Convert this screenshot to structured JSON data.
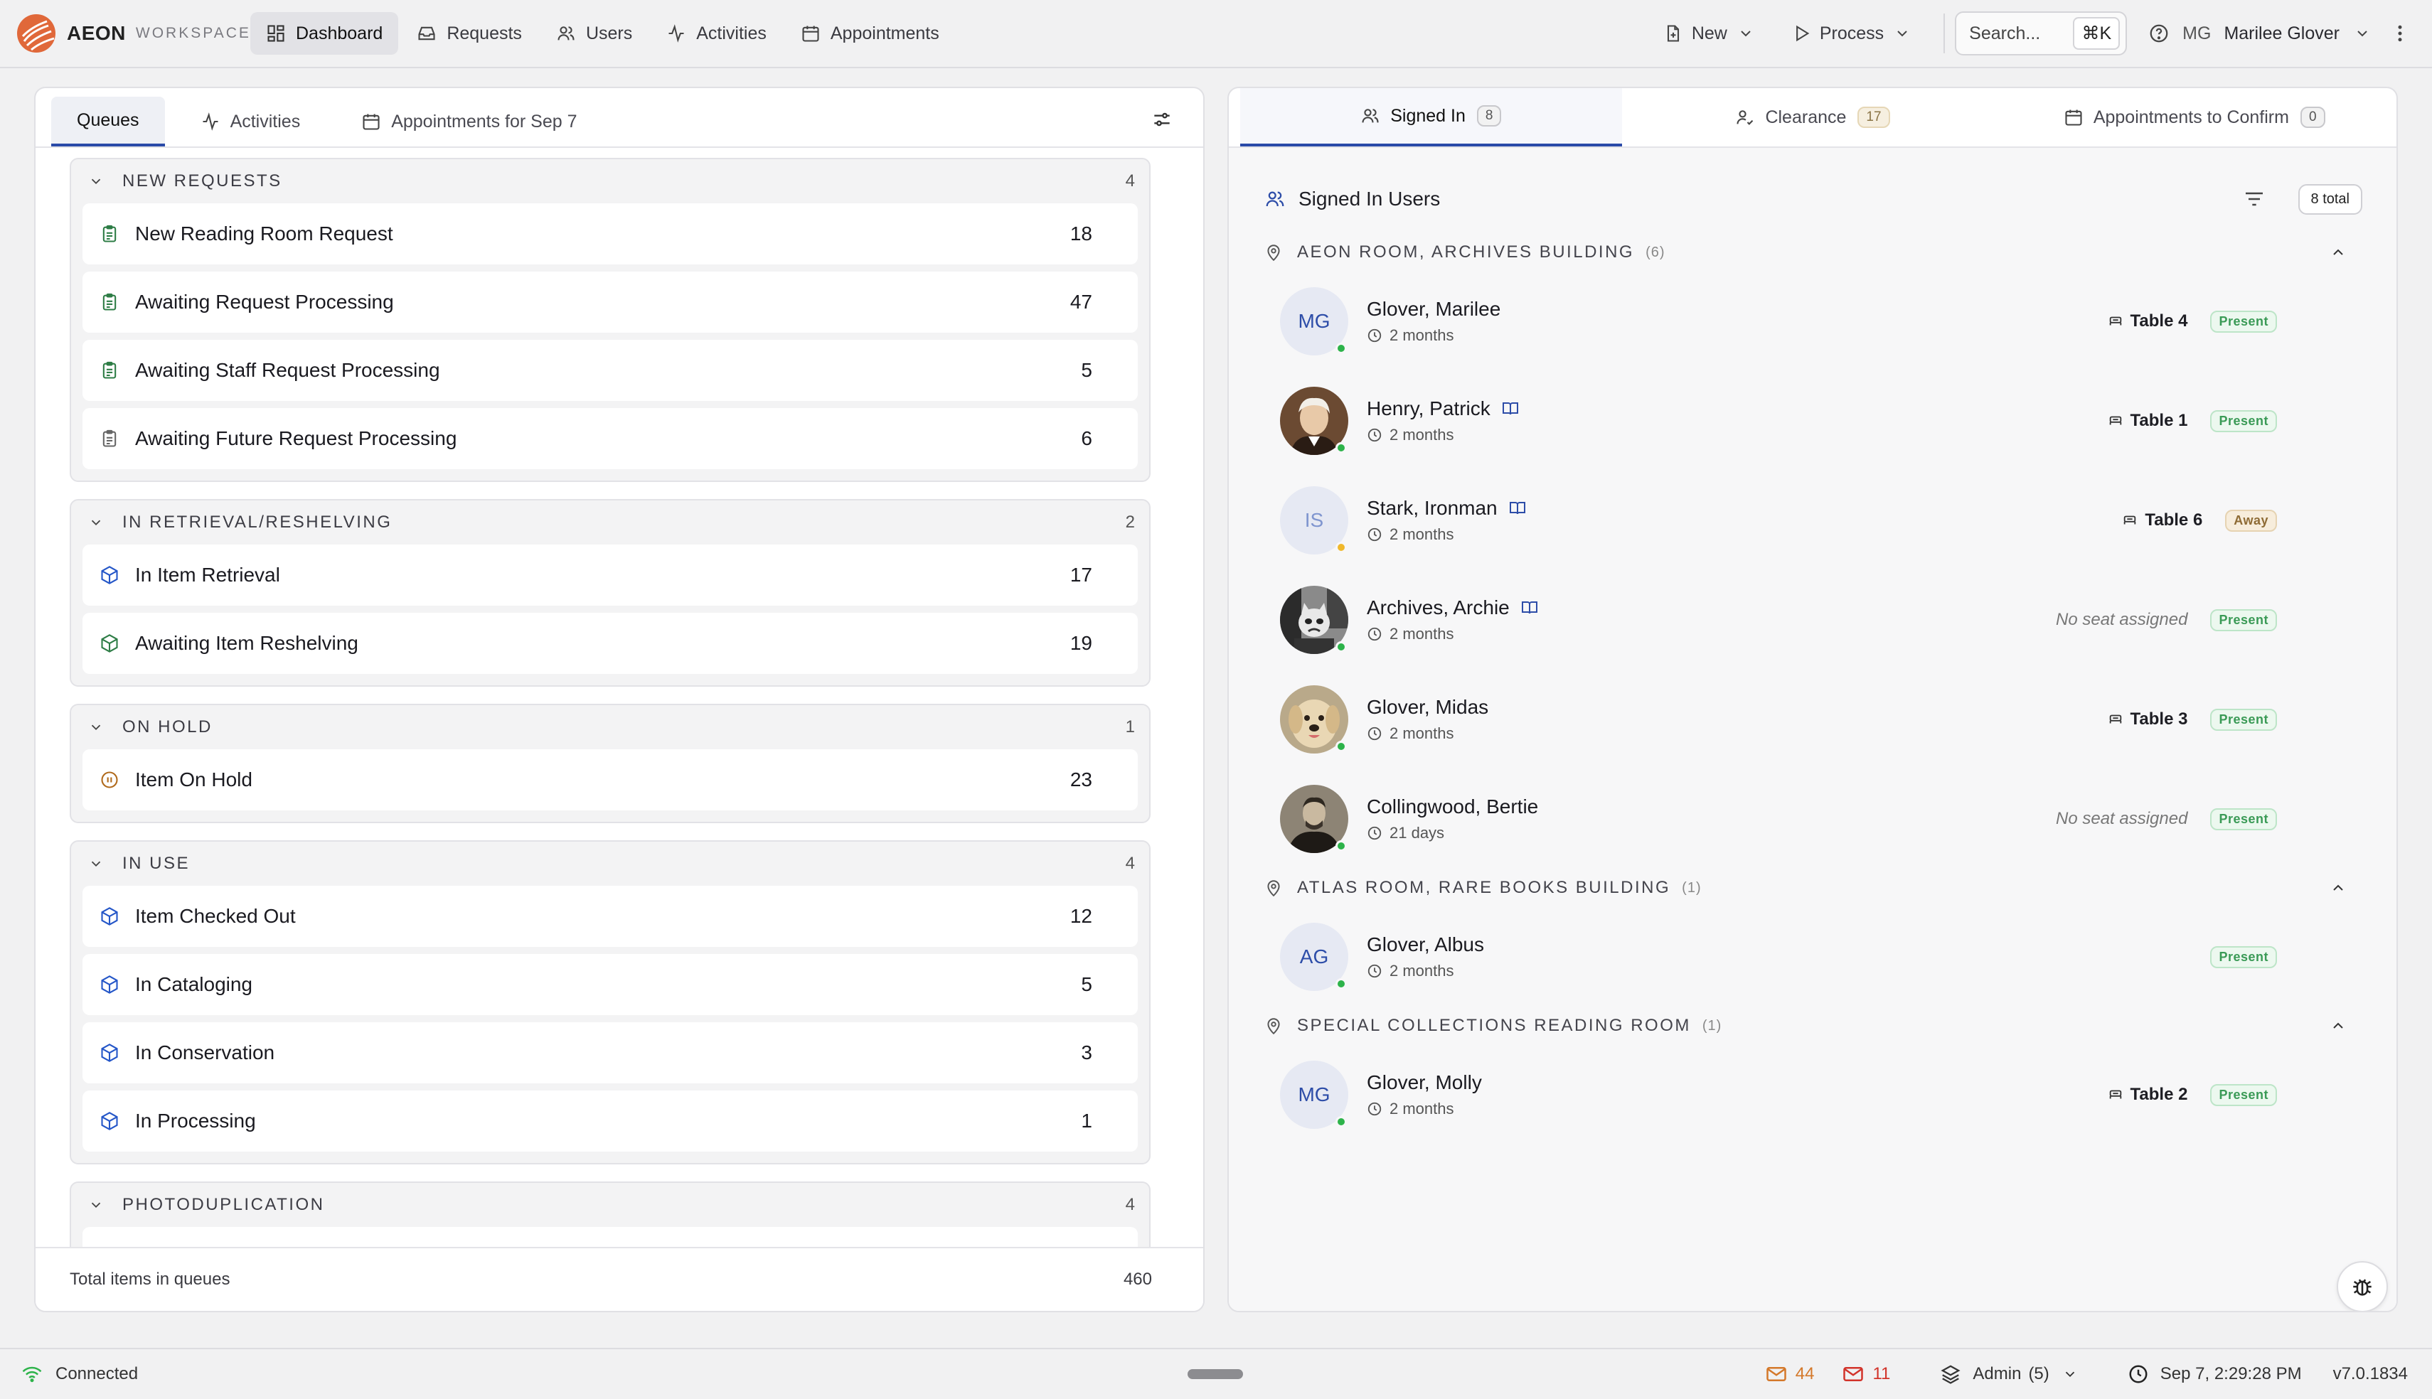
{
  "app": {
    "brand": "AEON",
    "sub": "WORKSPACE"
  },
  "nav": [
    {
      "label": "Dashboard",
      "icon": "dashboard-icon",
      "active": true
    },
    {
      "label": "Requests",
      "icon": "inbox-icon"
    },
    {
      "label": "Users",
      "icon": "users-icon"
    },
    {
      "label": "Activities",
      "icon": "activity-icon"
    },
    {
      "label": "Appointments",
      "icon": "calendar-icon"
    }
  ],
  "toolbar": {
    "new_label": "New",
    "process_label": "Process",
    "search_placeholder": "Search...",
    "search_kbd": "⌘K"
  },
  "user": {
    "initials": "MG",
    "name": "Marilee Glover"
  },
  "left": {
    "tabs": [
      {
        "label": "Queues",
        "active": true
      },
      {
        "label": "Activities"
      },
      {
        "label": "Appointments for Sep 7"
      }
    ],
    "groups": [
      {
        "title": "NEW REQUESTS",
        "count": "4",
        "items": [
          {
            "label": "New Reading Room Request",
            "count": "18",
            "icon": "clipboard",
            "color": "#2e7d46"
          },
          {
            "label": "Awaiting Request Processing",
            "count": "47",
            "icon": "clipboard",
            "color": "#2e7d46"
          },
          {
            "label": "Awaiting Staff Request Processing",
            "count": "5",
            "icon": "clipboard",
            "color": "#2e7d46"
          },
          {
            "label": "Awaiting Future Request Processing",
            "count": "6",
            "icon": "clipboard",
            "color": "#666666"
          }
        ]
      },
      {
        "title": "IN RETRIEVAL/RESHELVING",
        "count": "2",
        "items": [
          {
            "label": "In Item Retrieval",
            "count": "17",
            "icon": "box",
            "color": "#2456c8"
          },
          {
            "label": "Awaiting Item Reshelving",
            "count": "19",
            "icon": "box",
            "color": "#2e7d46"
          }
        ]
      },
      {
        "title": "ON HOLD",
        "count": "1",
        "items": [
          {
            "label": "Item On Hold",
            "count": "23",
            "icon": "pause",
            "color": "#b06a1c"
          }
        ]
      },
      {
        "title": "IN USE",
        "count": "4",
        "items": [
          {
            "label": "Item Checked Out",
            "count": "12",
            "icon": "box",
            "color": "#2456c8"
          },
          {
            "label": "In Cataloging",
            "count": "5",
            "icon": "box",
            "color": "#2456c8"
          },
          {
            "label": "In Conservation",
            "count": "3",
            "icon": "box",
            "color": "#2456c8"
          },
          {
            "label": "In Processing",
            "count": "1",
            "icon": "box",
            "color": "#2456c8"
          }
        ]
      },
      {
        "title": "PHOTODUPLICATION",
        "count": "4",
        "items": []
      }
    ],
    "footer": {
      "label": "Total items in queues",
      "total": "460"
    }
  },
  "right": {
    "tabs": [
      {
        "label": "Signed In",
        "badge": "8",
        "active": true
      },
      {
        "label": "Clearance",
        "badge": "17"
      },
      {
        "label": "Appointments to Confirm",
        "badge": "0"
      }
    ],
    "header": {
      "title": "Signed In Users",
      "total": "8 total"
    },
    "locations": [
      {
        "name": "AEON ROOM, ARCHIVES BUILDING",
        "count": "(6)",
        "users": [
          {
            "name": "Glover, Marilee",
            "time": "2 months",
            "avatar": "initials",
            "initials": "MG",
            "seat": "Table 4",
            "status": "Present",
            "online": "green",
            "card": false
          },
          {
            "name": "Henry, Patrick",
            "time": "2 months",
            "avatar": "portrait-henry",
            "seat": "Table 1",
            "status": "Present",
            "online": "green",
            "card": true
          },
          {
            "name": "Stark, Ironman",
            "time": "2 months",
            "avatar": "initials-faint",
            "initials": "IS",
            "seat": "Table 6",
            "status": "Away",
            "online": "amber",
            "card": true
          },
          {
            "name": "Archives, Archie",
            "time": "2 months",
            "avatar": "photo-cat",
            "seat": "No seat assigned",
            "status": "Present",
            "online": "green",
            "card": true
          },
          {
            "name": "Glover, Midas",
            "time": "2 months",
            "avatar": "photo-dog",
            "seat": "Table 3",
            "status": "Present",
            "online": "green",
            "card": false
          },
          {
            "name": "Collingwood, Bertie",
            "time": "21 days",
            "avatar": "portrait-bertie",
            "seat": "No seat assigned",
            "status": "Present",
            "online": "green",
            "card": false
          }
        ]
      },
      {
        "name": "ATLAS ROOM, RARE BOOKS BUILDING",
        "count": "(1)",
        "users": [
          {
            "name": "Glover, Albus",
            "time": "2 months",
            "avatar": "initials",
            "initials": "AG",
            "seat": "",
            "status": "Present",
            "online": "green",
            "card": false
          }
        ]
      },
      {
        "name": "SPECIAL COLLECTIONS READING ROOM",
        "count": "(1)",
        "users": [
          {
            "name": "Glover, Molly",
            "time": "2 months",
            "avatar": "initials",
            "initials": "MG",
            "seat": "Table 2",
            "status": "Present",
            "online": "green",
            "card": false
          }
        ]
      }
    ]
  },
  "statusbar": {
    "connection": "Connected",
    "mail1": "44",
    "mail2": "11",
    "role": "Admin",
    "role_count": "(5)",
    "datetime": "Sep 7, 2:29:28 PM",
    "version": "v7.0.1834"
  }
}
